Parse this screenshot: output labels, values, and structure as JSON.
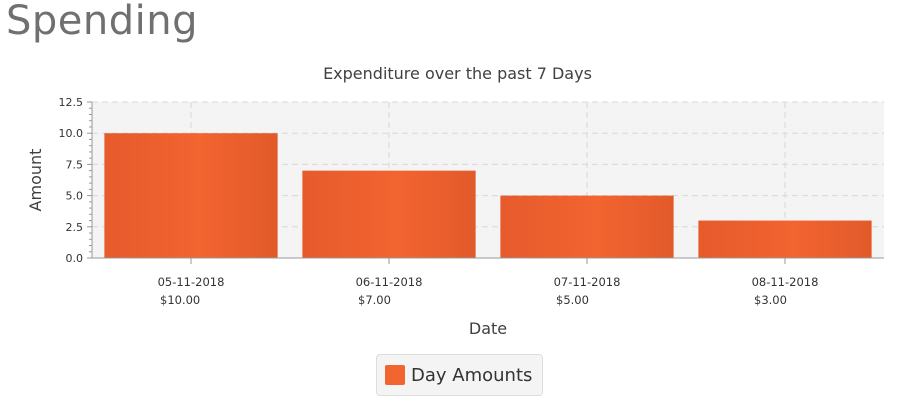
{
  "page": {
    "title": "Spending"
  },
  "chart_data": {
    "type": "bar",
    "title": "Expenditure over the past 7 Days",
    "xlabel": "Date",
    "ylabel": "Amount",
    "ylim": [
      0,
      12.5
    ],
    "yticks": [
      "0.0",
      "2.5",
      "5.0",
      "7.5",
      "10.0",
      "12.5"
    ],
    "categories": [
      "05-11-2018",
      "06-11-2018",
      "07-11-2018",
      "08-11-2018"
    ],
    "category_sublabels": [
      "$10.00",
      "$7.00",
      "$5.00",
      "$3.00"
    ],
    "series": [
      {
        "name": "Day Amounts",
        "values": [
          10,
          7,
          5,
          3
        ],
        "color": "#f26430"
      }
    ],
    "grid": true,
    "legend_position": "bottom-center",
    "plot_background": "#f4f4f4"
  }
}
